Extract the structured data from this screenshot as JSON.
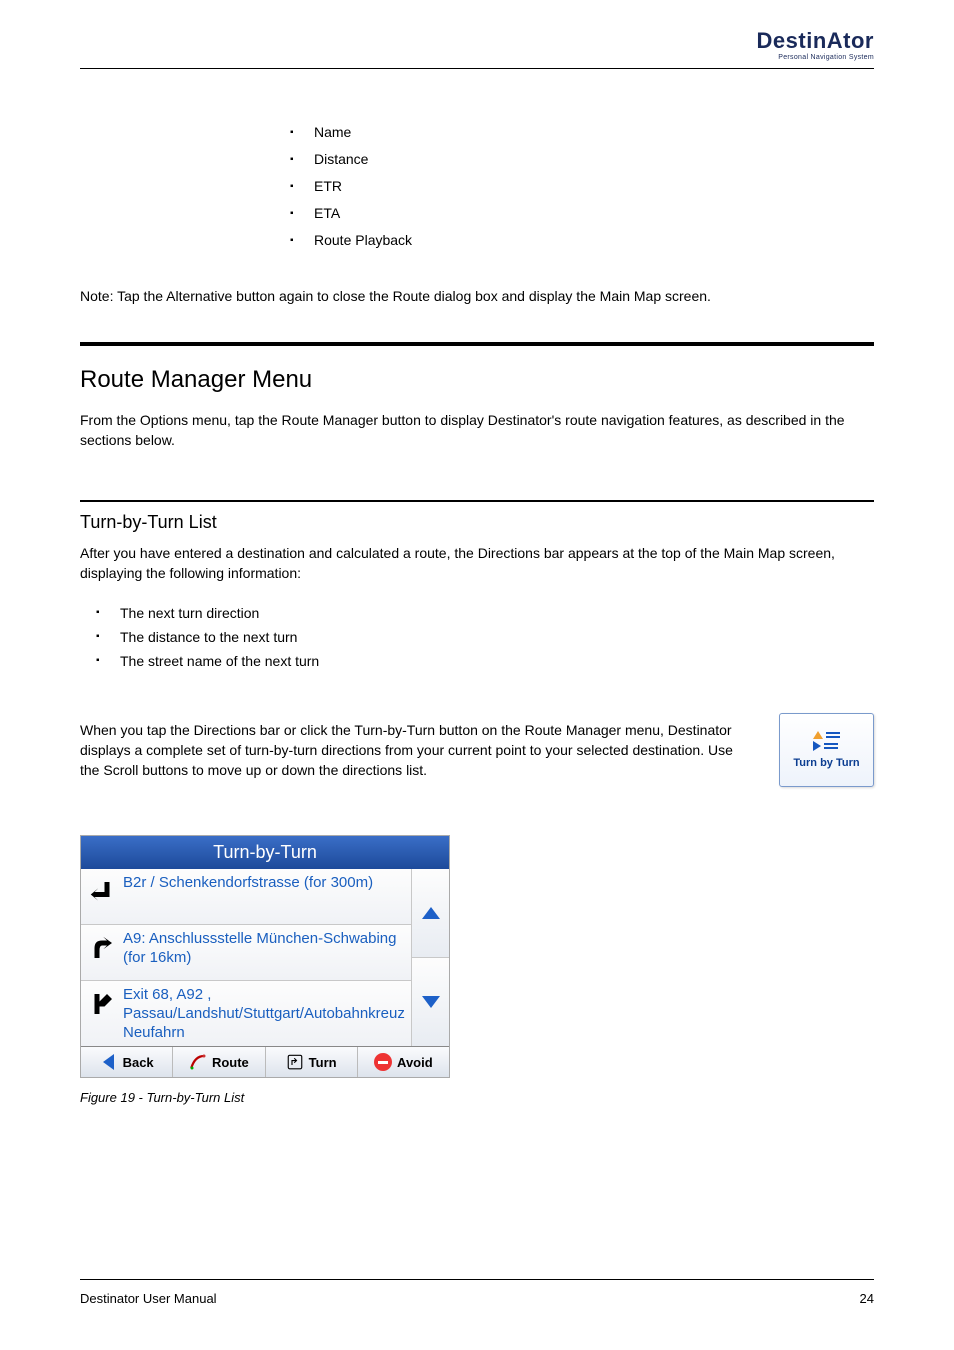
{
  "header": {
    "logo_main": "DestinAtor",
    "logo_sub": "Personal Navigation System"
  },
  "list1": [
    "Name",
    "Distance",
    "ETR",
    "ETA",
    "Route Playback"
  ],
  "note": "Note: Tap the Alternative button again to close the Route dialog box and display the Main Map screen.",
  "section": {
    "title": "Route Manager Menu",
    "intro": "From the Options menu, tap the Route Manager button to display Destinator's route navigation features, as described in the sections below."
  },
  "sub": {
    "title": "Turn-by-Turn List",
    "intro": "After you have entered a destination and calculated a route, the Directions bar appears at the top of the Main Map screen, displaying the following information:",
    "items": [
      "The next turn direction",
      "The distance to the next turn",
      "The street name of the next turn"
    ]
  },
  "tbt": {
    "text": "When you tap the Directions bar or click the Turn-by-Turn button on the Route Manager menu, Destinator displays a complete set of turn-by-turn directions from your current point to your selected destination. Use the Scroll buttons to move up or down the directions list.",
    "button_label": "Turn by Turn"
  },
  "screenshot": {
    "title": "Turn-by-Turn",
    "items": [
      "B2r / Schenkendorfstrasse (for 300m)",
      "A9: Anschlussstelle München-Schwabing (for 16km)",
      "Exit  68, A92 , Passau/Landshut/Stuttgart/Autobahnkreuz Neufahrn"
    ],
    "toolbar": {
      "back": "Back",
      "route": "Route",
      "turn": "Turn",
      "avoid": "Avoid"
    }
  },
  "caption": "Figure 19 - Turn-by-Turn List",
  "footer": {
    "left": "Destinator User Manual",
    "right": "24"
  }
}
